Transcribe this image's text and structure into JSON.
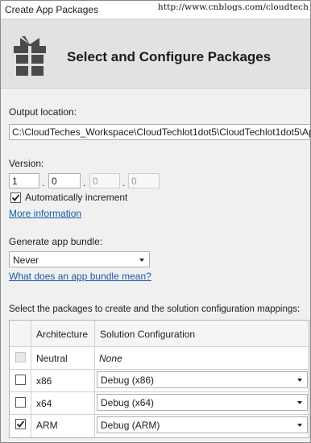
{
  "window": {
    "title": "Create App Packages",
    "watermark": "http://www.cnblogs.com/cloudtech"
  },
  "header": {
    "title": "Select and Configure Packages",
    "icon": "gift-box-icon"
  },
  "output": {
    "label": "Output location:",
    "value": "C:\\CloudTeches_Workspace\\CloudTechlot1dot5\\CloudTechlot1dot5\\Ap"
  },
  "version": {
    "label": "Version:",
    "major": "1",
    "minor": "0",
    "build": "0",
    "revision": "0",
    "auto_increment_label": "Automatically increment",
    "auto_increment_checked": true,
    "more_info_link": "More information"
  },
  "bundle": {
    "label": "Generate app bundle:",
    "selected": "Never",
    "help_link": "What does an app bundle mean?"
  },
  "packages": {
    "instructions": "Select the packages to create and the solution configuration mappings:",
    "columns": [
      "Architecture",
      "Solution Configuration"
    ],
    "rows": [
      {
        "architecture": "Neutral",
        "configuration": "None",
        "checked": false,
        "enabled": false
      },
      {
        "architecture": "x86",
        "configuration": "Debug (x86)",
        "checked": false,
        "enabled": true
      },
      {
        "architecture": "x64",
        "configuration": "Debug (x64)",
        "checked": false,
        "enabled": true
      },
      {
        "architecture": "ARM",
        "configuration": "Debug (ARM)",
        "checked": true,
        "enabled": true
      }
    ]
  },
  "colors": {
    "link": "#1a5aa8",
    "header_band": "#e2e2e2",
    "icon": "#4a4a4a"
  }
}
